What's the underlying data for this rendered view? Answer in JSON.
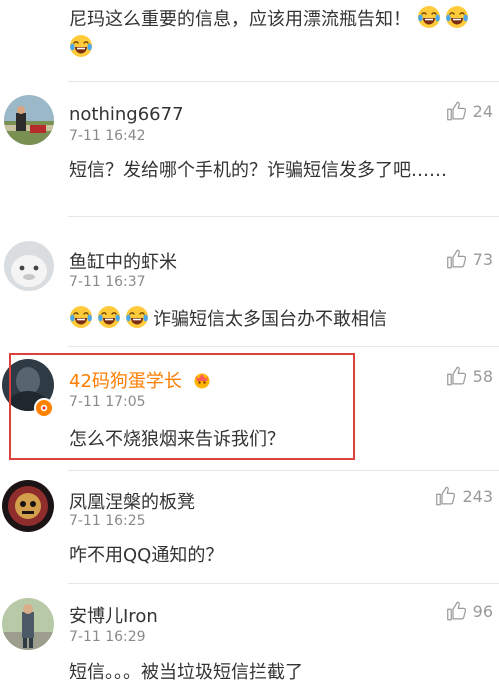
{
  "comments": [
    {
      "body": "尼玛这么重要的信息，应该用漂流瓶告知！",
      "emoji_count": 3,
      "emoji": "laugh-cry"
    },
    {
      "username": "nothing6677",
      "time": "7-11 16:42",
      "likes": "24",
      "body": "短信？发给哪个手机的？诈骗短信发多了吧……"
    },
    {
      "username": "鱼缸中的虾米",
      "time": "7-11 16:37",
      "likes": "73",
      "body": "诈骗短信太多国台办不敢相信",
      "emoji_count": 3,
      "emoji": "laugh-cry"
    },
    {
      "username": "42码狗蛋学长",
      "time": "7-11 17:05",
      "likes": "58",
      "body": "怎么不烧狼烟来告诉我们？",
      "highlighted": true,
      "verified": true,
      "highlight_color": "#e0403c",
      "username_color": "#ff7d00"
    },
    {
      "username": "凤凰涅槃的板凳",
      "time": "7-11 16:25",
      "likes": "243",
      "body": "咋不用QQ通知的？"
    },
    {
      "username": "安博儿Iron",
      "time": "7-11 16:29",
      "likes": "96",
      "body": "短信。。。被当垃圾短信拦截了"
    }
  ],
  "colors": {
    "text": "#333333",
    "meta": "#8a8a8a",
    "like_icon": "#9a9a9a",
    "divider": "#e6e6e6"
  }
}
